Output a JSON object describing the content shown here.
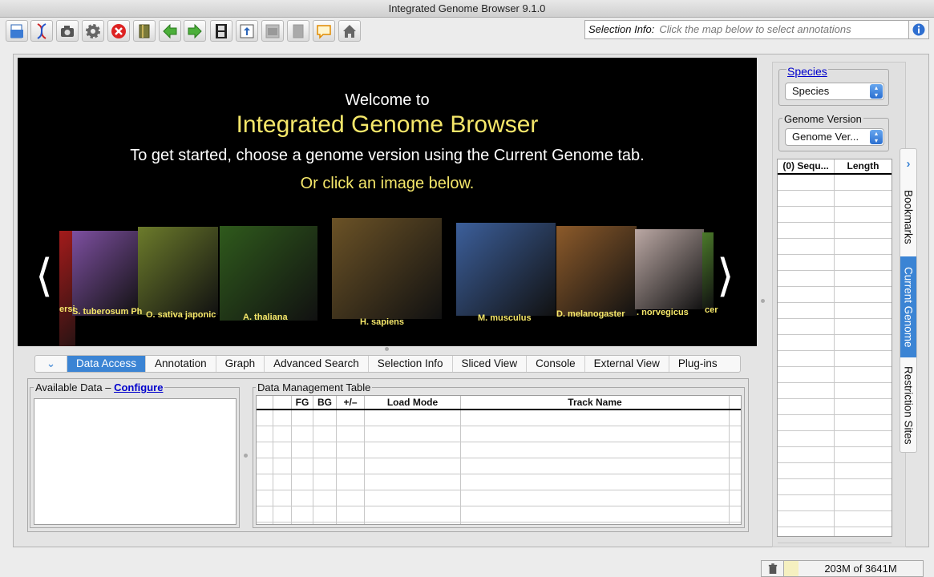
{
  "window": {
    "title": "Integrated Genome Browser 9.1.0"
  },
  "toolbar": {
    "buttons": [
      "open-file-icon",
      "dna-icon",
      "camera-icon",
      "gear-icon",
      "stop-icon",
      "bookmark-icon",
      "back-arrow-icon",
      "forward-arrow-icon",
      "film-icon",
      "upload-icon",
      "window-icon",
      "disabled-icon",
      "comment-icon",
      "home-icon"
    ],
    "selection_info_label": "Selection Info:",
    "selection_info_placeholder": "Click the map below to select annotations"
  },
  "welcome": {
    "line1": "Welcome to",
    "line2": "Integrated Genome Browser",
    "line3": "To get started, choose a genome version using the Current Genome tab.",
    "line4": "Or click an image below.",
    "species": [
      {
        "label": "S. tuberosum Ph",
        "color": "#7d4fa0"
      },
      {
        "label": "O. sativa japonic",
        "color": "#6c7b2b"
      },
      {
        "label": "A. thaliana",
        "color": "#2f5a1c"
      },
      {
        "label": "H. sapiens",
        "color": "#6b5226"
      },
      {
        "label": "M. musculus",
        "color": "#3c5f9b"
      },
      {
        "label": "D. melanogaster",
        "color": "#8c5a2a"
      },
      {
        "label": ". norvegicus",
        "color": "#bba8a4"
      },
      {
        "label": "cer",
        "color": "#4b7a2a"
      },
      {
        "label": "ersi",
        "color": "#a31b1b"
      }
    ]
  },
  "tabs": [
    "Data Access",
    "Annotation",
    "Graph",
    "Advanced Search",
    "Selection Info",
    "Sliced View",
    "Console",
    "External View",
    "Plug-ins"
  ],
  "data_access": {
    "available_label": "Available Data",
    "available_sep": "–",
    "configure_link": "Configure",
    "dmt_label": "Data Management Table",
    "dmt_columns": [
      "",
      "",
      "FG",
      "BG",
      "+/–",
      "Load Mode",
      "Track Name",
      ""
    ]
  },
  "right_panel": {
    "species_link": "Species",
    "species_select": "Species",
    "genome_version_label": "Genome Version",
    "genome_version_select": "Genome Ver...",
    "columns": [
      "(0) Sequ...",
      "Length"
    ],
    "vertical_tabs": [
      "Bookmarks",
      "Current Genome",
      "Restriction Sites"
    ]
  },
  "status": {
    "memory": "203M of 3641M"
  }
}
